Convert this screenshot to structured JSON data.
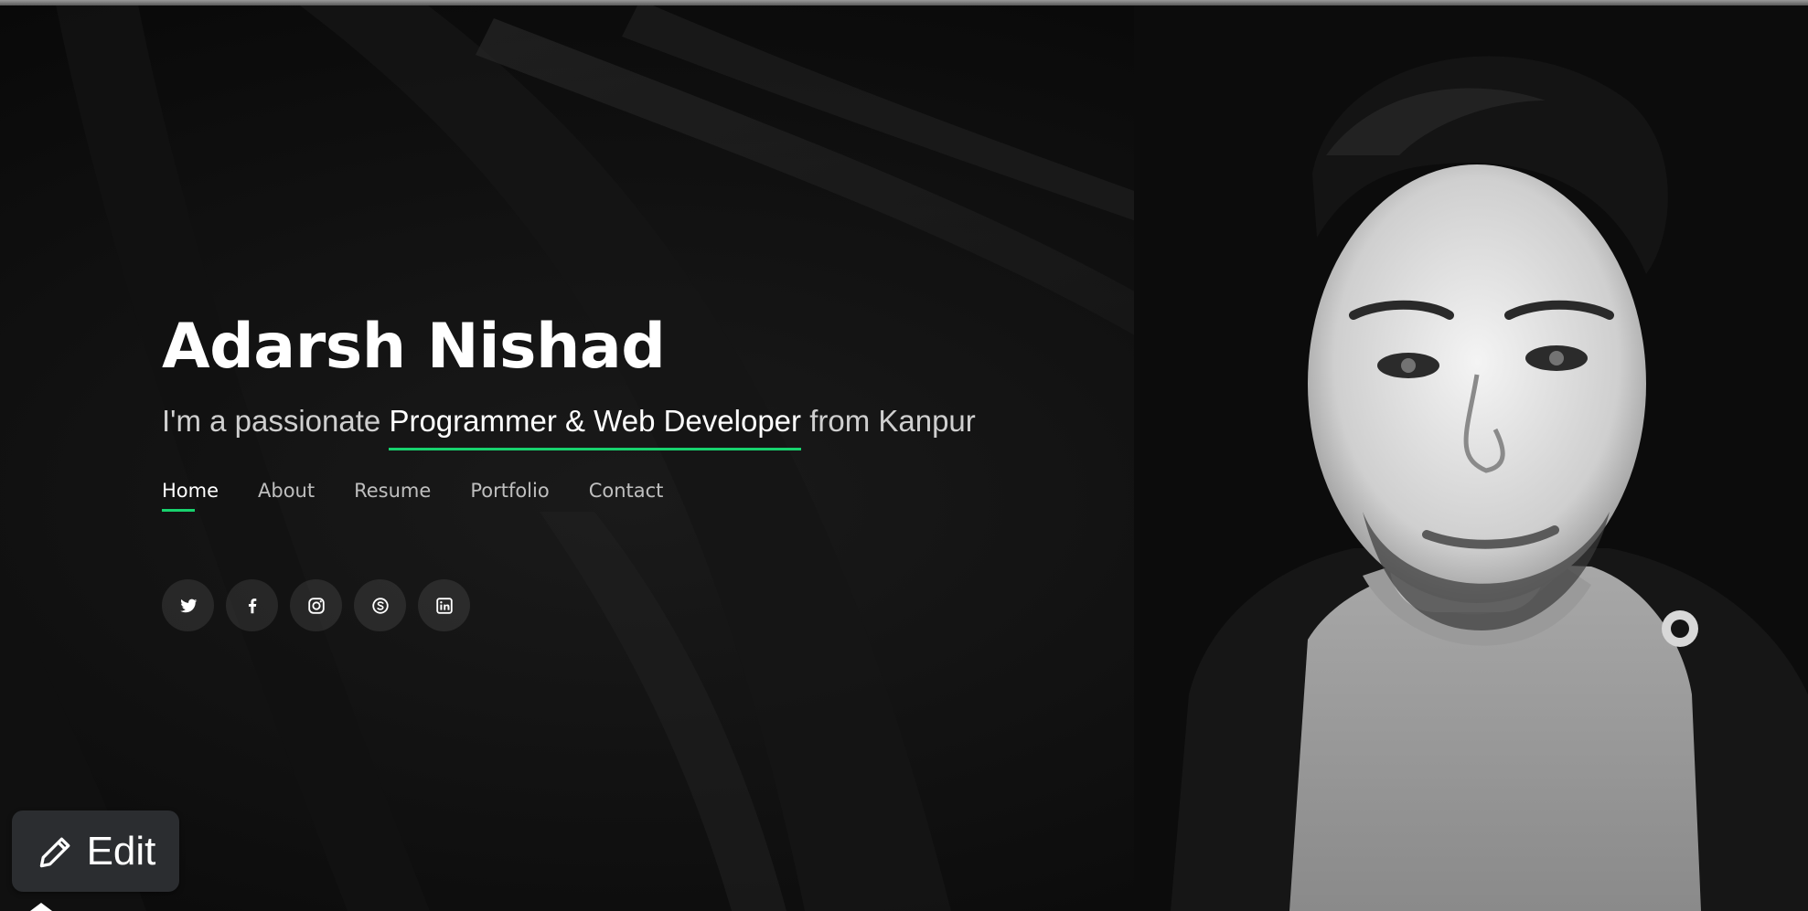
{
  "hero": {
    "name": "Adarsh Nishad",
    "tagline_prefix": "I'm a passionate",
    "tagline_highlight": "Programmer & Web Developer",
    "tagline_suffix": "from Kanpur"
  },
  "nav": {
    "items": [
      {
        "label": "Home",
        "active": true
      },
      {
        "label": "About",
        "active": false
      },
      {
        "label": "Resume",
        "active": false
      },
      {
        "label": "Portfolio",
        "active": false
      },
      {
        "label": "Contact",
        "active": false
      }
    ]
  },
  "social": {
    "icons": [
      "twitter-icon",
      "facebook-icon",
      "instagram-icon",
      "skype-icon",
      "linkedin-icon"
    ]
  },
  "edit_button": {
    "label": "Edit",
    "icon": "pencil-icon"
  },
  "colors": {
    "accent": "#18d26e",
    "background": "#0d0d0d",
    "text": "#ffffff",
    "muted_text": "#cfcfcf",
    "edit_button_bg": "#2b2d30"
  }
}
